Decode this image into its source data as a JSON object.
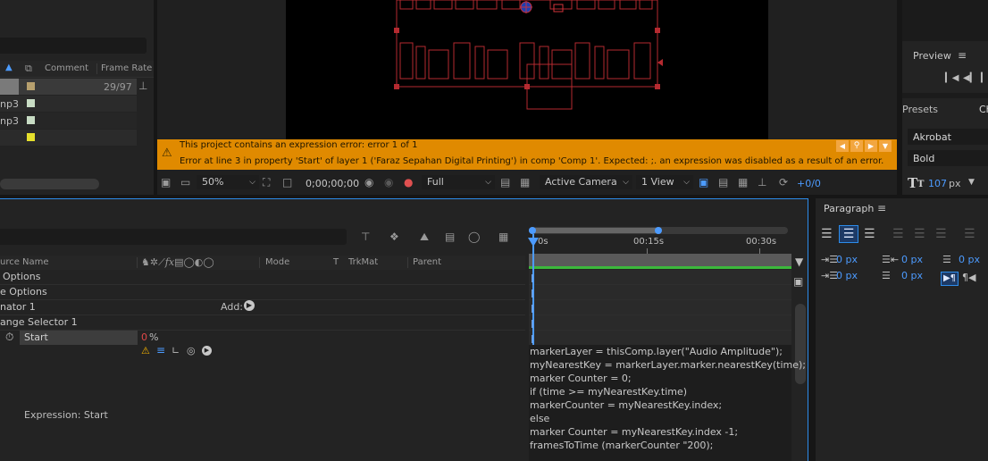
{
  "project": {
    "columns": {
      "comment": "Comment",
      "frame_rate": "Frame Rate"
    },
    "rows": [
      {
        "suffix": "",
        "frame_rate": "29/97",
        "color": "#b7a06e",
        "selected": true
      },
      {
        "suffix": "np3",
        "frame_rate": "",
        "color": "#c8dcc4",
        "selected": false
      },
      {
        "suffix": "np3",
        "frame_rate": "",
        "color": "#c8dcc4",
        "selected": false
      },
      {
        "suffix": "",
        "frame_rate": "",
        "color": "#e6e02c",
        "selected": false
      }
    ]
  },
  "error_bar": {
    "line1": "This project contains an expression error: error 1 of 1",
    "line2": "Error at line 3 in property 'Start' of layer 1 ('Faraz Sepahan Digital Printing') in comp 'Comp 1'. Expected: ;. an expression was disabled as a result of an error."
  },
  "viewer_toolbar": {
    "zoom": "50%",
    "timecode": "0;00;00;00",
    "resolution": "Full",
    "camera": "Active Camera",
    "views": "1 View",
    "exposure": "+0/0"
  },
  "preview": {
    "title": "Preview"
  },
  "effects": {
    "title": "Presets",
    "tab_partial": "Ch"
  },
  "character": {
    "font": "Akrobat",
    "style": "Bold",
    "size": "107",
    "size_unit": "px"
  },
  "paragraph": {
    "title": "Paragraph",
    "indent_left": "0 px",
    "indent_right": "0 px",
    "space_before": "0 px",
    "indent_first": "0 px",
    "space_after": "0 px"
  },
  "timeline": {
    "columns": {
      "source_name": "urce Name",
      "mode": "Mode",
      "t": "T",
      "trkmat": "TrkMat",
      "parent": "Parent"
    },
    "ruler": {
      "start": "0s",
      "mid": "00:15s",
      "end": "00:30s"
    },
    "layers": [
      {
        "label": "Options",
        "indent": 3
      },
      {
        "label": "e Options",
        "indent": 0
      },
      {
        "label": "nator 1",
        "indent": 0
      },
      {
        "label": "ange Selector 1",
        "indent": 0
      }
    ],
    "add_label": "Add:",
    "start_label": "Start",
    "start_value": "0",
    "start_unit": "%",
    "expression_label": "Expression: Start",
    "expression_lines": [
      "markerLayer = thisComp.layer(\"Audio Amplitude\");",
      "myNearestKey = markerLayer.marker.nearestKey(time);",
      "marker Counter = 0;",
      "if (time >= myNearestKey.time)",
      "markerCounter = myNearestKey.index;",
      "else",
      "marker Counter = myNearestKey.index -1;",
      "framesToTime (markerCounter \"200);"
    ]
  },
  "colors": {
    "error_bar": "#e08a00",
    "accent": "#2d8ceb",
    "green_bar": "#3cb83c",
    "viewer_red": "#d1343a"
  }
}
